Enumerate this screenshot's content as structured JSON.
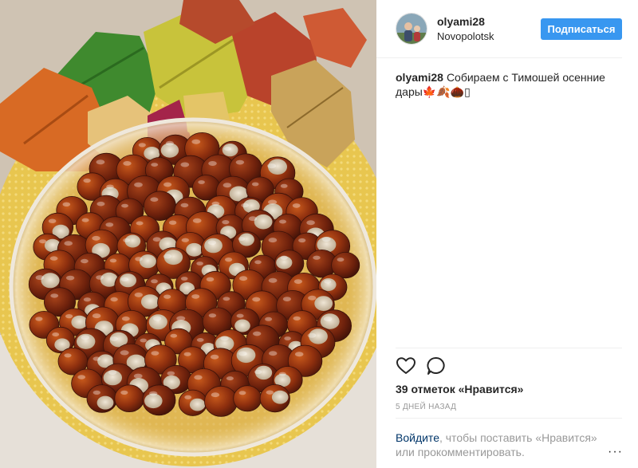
{
  "post": {
    "username": "olyami28",
    "location": "Novopolotsk",
    "follow_label": "Подписаться",
    "caption_username": "olyami28",
    "caption_text": "Собираем с Тимошей осенние дары🍁🍂🌰▯",
    "likes_text": "39 отметок «Нравится»",
    "time_ago": "5 дней назад",
    "login_link": "Войдите",
    "login_text": ", чтобы поставить «Нравится» или прокомментировать.",
    "more_label": "···"
  },
  "icons": {
    "like": "heart-outline-icon",
    "comment": "speech-bubble-icon",
    "more": "more-options-icon",
    "avatar": "user-avatar"
  },
  "colors": {
    "follow_button": "#3897f0",
    "link": "#003569",
    "muted": "#999999",
    "text": "#262626",
    "divider": "#efefef"
  }
}
